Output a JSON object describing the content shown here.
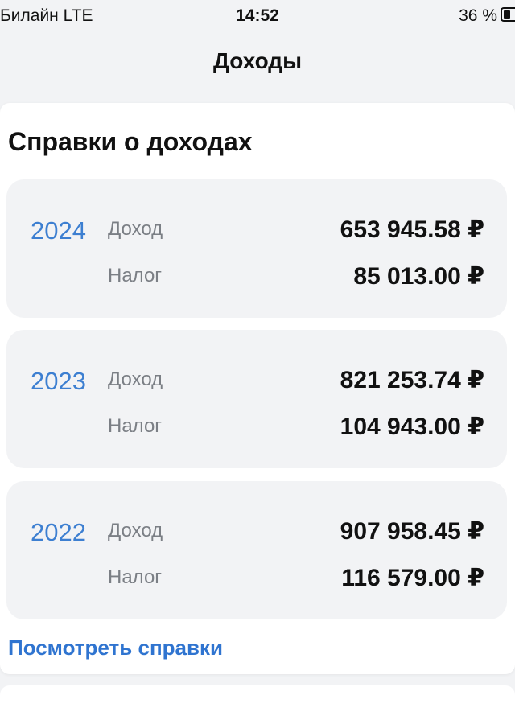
{
  "status_bar": {
    "carrier": "Билайн  LTE",
    "time": "14:52",
    "battery": "36 %"
  },
  "header": {
    "title": "Доходы",
    "back_icon": "chevron-left-icon"
  },
  "section": {
    "title": "Справки о доходах",
    "income_label": "Доход",
    "tax_label": "Налог",
    "records": [
      {
        "year": "2024",
        "income": "653 945.58 ₽",
        "tax": "85 013.00 ₽"
      },
      {
        "year": "2023",
        "income": "821 253.74 ₽",
        "tax": "104 943.00 ₽"
      },
      {
        "year": "2022",
        "income": "907 958.45 ₽",
        "tax": "116 579.00 ₽"
      }
    ],
    "view_link": "Посмотреть справки"
  },
  "colors": {
    "accent": "#3d7fd1",
    "link": "#2f74d0",
    "muted": "#7b7f85",
    "background": "#f2f3f5"
  }
}
